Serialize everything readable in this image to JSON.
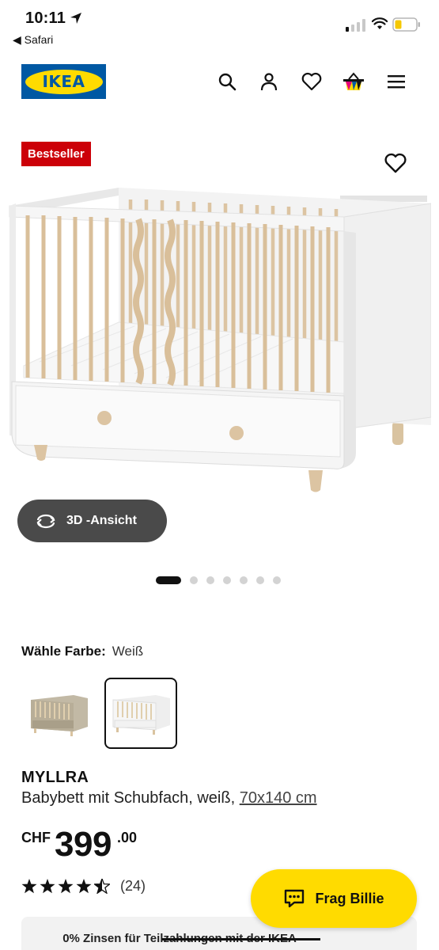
{
  "status_bar": {
    "time": "10:11",
    "back_app": "◀ Safari"
  },
  "header": {
    "logo_text": "IKEA",
    "icons": [
      "search-icon",
      "user-icon",
      "heart-icon",
      "shopping-bag-icon",
      "menu-icon"
    ]
  },
  "product_image": {
    "badge": "Bestseller",
    "view_3d_label": "3D -Ansicht",
    "carousel_count": 7,
    "carousel_active": 1
  },
  "color_choice": {
    "label": "Wähle Farbe:",
    "value": "Weiß",
    "swatches": [
      {
        "name": "Grau-Grün",
        "selected": false
      },
      {
        "name": "Weiß",
        "selected": true
      }
    ]
  },
  "product": {
    "name": "MYLLRA",
    "description": "Babybett mit Schubfach, weiß,",
    "size_link": "70x140 cm",
    "currency": "CHF",
    "price_int": "399",
    "price_dec": ".00",
    "rating": 4.5,
    "rating_count": "(24)"
  },
  "chat": {
    "label": "Frag Billie"
  },
  "promo": {
    "text": "0% Zinsen für Teilzahlungen mit der IKEA"
  },
  "colors": {
    "ikea_blue": "#0058a3",
    "ikea_yellow": "#ffdb00",
    "badge_red": "#cc0008"
  }
}
